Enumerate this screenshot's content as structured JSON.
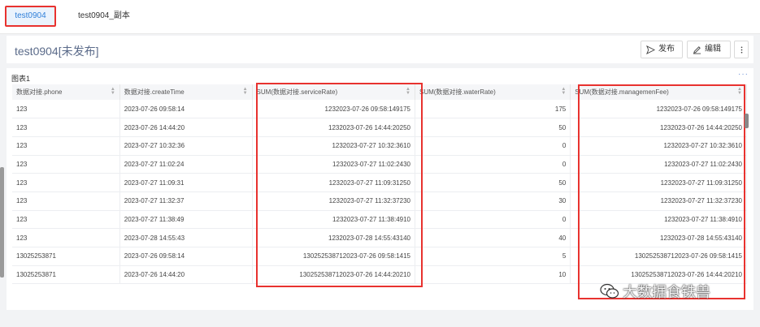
{
  "tabs": [
    {
      "label": "test0904"
    },
    {
      "label": "test0904_副本"
    }
  ],
  "header": {
    "title": "test0904[未发布]",
    "publish_label": "发布",
    "edit_label": "编辑"
  },
  "card": {
    "title": "图表1",
    "more": "···"
  },
  "table": {
    "columns": [
      "数据对接.phone",
      "数据对接.createTime",
      "SUM(数据对接.serviceRate)",
      "SUM(数据对接.waterRate)",
      "SUM(数据对接.managemenFee)"
    ],
    "rows": [
      [
        "123",
        "2023-07-26 09:58:14",
        "1232023-07-26 09:58:149175",
        "175",
        "1232023-07-26 09:58:149175"
      ],
      [
        "123",
        "2023-07-26 14:44:20",
        "1232023-07-26 14:44:20250",
        "50",
        "1232023-07-26 14:44:20250"
      ],
      [
        "123",
        "2023-07-27 10:32:36",
        "1232023-07-27 10:32:3610",
        "0",
        "1232023-07-27 10:32:3610"
      ],
      [
        "123",
        "2023-07-27 11:02:24",
        "1232023-07-27 11:02:2430",
        "0",
        "1232023-07-27 11:02:2430"
      ],
      [
        "123",
        "2023-07-27 11:09:31",
        "1232023-07-27 11:09:31250",
        "50",
        "1232023-07-27 11:09:31250"
      ],
      [
        "123",
        "2023-07-27 11:32:37",
        "1232023-07-27 11:32:37230",
        "30",
        "1232023-07-27 11:32:37230"
      ],
      [
        "123",
        "2023-07-27 11:38:49",
        "1232023-07-27 11:38:4910",
        "0",
        "1232023-07-27 11:38:4910"
      ],
      [
        "123",
        "2023-07-28 14:55:43",
        "1232023-07-28 14:55:43140",
        "40",
        "1232023-07-28 14:55:43140"
      ],
      [
        "13025253871",
        "2023-07-26 09:58:14",
        "130252538712023-07-26 09:58:1415",
        "5",
        "130252538712023-07-26 09:58:1415"
      ],
      [
        "13025253871",
        "2023-07-26 14:44:20",
        "130252538712023-07-26 14:44:20210",
        "10",
        "130252538712023-07-26 14:44:20210"
      ]
    ]
  },
  "watermark": {
    "text": "大数据食铁兽",
    "icon": "wechat-icon"
  },
  "colors": {
    "highlight": "#e8322f",
    "accent": "#2f7fd9"
  }
}
